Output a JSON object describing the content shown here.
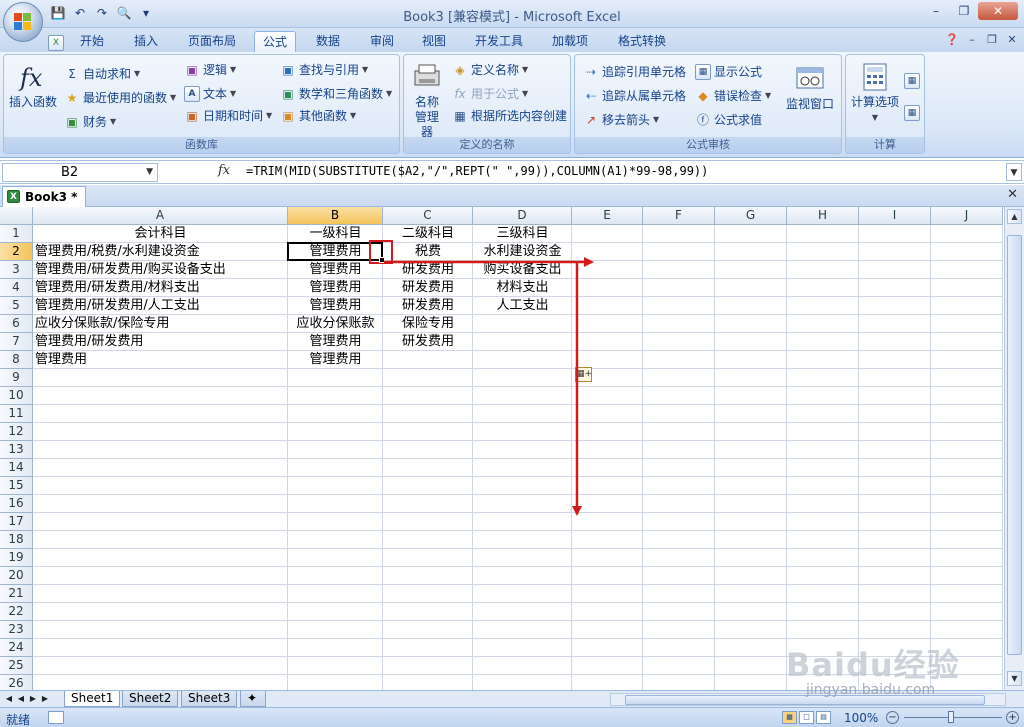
{
  "window": {
    "title": "Book3  [兼容模式] - Microsoft Excel"
  },
  "tabs": [
    {
      "label": "开始"
    },
    {
      "label": "插入"
    },
    {
      "label": "页面布局"
    },
    {
      "label": "公式",
      "active": true
    },
    {
      "label": "数据"
    },
    {
      "label": "审阅"
    },
    {
      "label": "视图"
    },
    {
      "label": "开发工具"
    },
    {
      "label": "加载项"
    },
    {
      "label": "格式转换"
    }
  ],
  "ribbon": {
    "function_library": {
      "label": "函数库",
      "insert_function": "插入函数",
      "autosum": "自动求和",
      "recent": "最近使用的函数",
      "financial": "财务",
      "logical": "逻辑",
      "text": "文本",
      "datetime": "日期和时间",
      "lookup": "查找与引用",
      "math": "数学和三角函数",
      "more": "其他函数"
    },
    "defined_names": {
      "label": "定义的名称",
      "name_manager": "名称管理器",
      "define_name": "定义名称",
      "use_in_formula": "用于公式",
      "create_from_selection": "根据所选内容创建"
    },
    "formula_auditing": {
      "label": "公式审核",
      "trace_precedents": "追踪引用单元格",
      "trace_dependents": "追踪从属单元格",
      "remove_arrows": "移去箭头",
      "show_formulas": "显示公式",
      "error_checking": "错误检查",
      "evaluate": "公式求值",
      "watch_window": "监视窗口"
    },
    "calculation": {
      "label": "计算",
      "options": "计算选项"
    }
  },
  "formula_bar": {
    "name_box": "B2",
    "fx": "fx",
    "formula": "=TRIM(MID(SUBSTITUTE($A2,\"/\",REPT(\" \",99)),COLUMN(A1)*99-98,99))"
  },
  "workbook_tab": "Book3 *",
  "columns": [
    "A",
    "B",
    "C",
    "D",
    "E",
    "F",
    "G",
    "H",
    "I",
    "J"
  ],
  "rows": [
    "1",
    "2",
    "3",
    "4",
    "5",
    "6",
    "7",
    "8",
    "9",
    "10",
    "11",
    "12",
    "13",
    "14",
    "15",
    "16",
    "17",
    "18",
    "19",
    "20",
    "21",
    "22",
    "23",
    "24",
    "25",
    "26"
  ],
  "cells": {
    "A1": "会计科目",
    "B1": "一级科目",
    "C1": "二级科目",
    "D1": "三级科目",
    "A2": "管理费用/税费/水利建设资金",
    "B2": "管理费用",
    "C2": "税费",
    "D2": "水利建设资金",
    "A3": "管理费用/研发费用/购买设备支出",
    "B3": "管理费用",
    "C3": "研发费用",
    "D3": "购买设备支出",
    "A4": "管理费用/研发费用/材料支出",
    "B4": "管理费用",
    "C4": "研发费用",
    "D4": "材料支出",
    "A5": "管理费用/研发费用/人工支出",
    "B5": "管理费用",
    "C5": "研发费用",
    "D5": "人工支出",
    "A6": "应收分保账款/保险专用",
    "B6": "应收分保账款",
    "C6": "保险专用",
    "A7": "管理费用/研发费用",
    "B7": "管理费用",
    "C7": "研发费用",
    "A8": "管理费用",
    "B8": "管理费用"
  },
  "sheets": [
    "Sheet1",
    "Sheet2",
    "Sheet3"
  ],
  "status": {
    "ready": "就绪",
    "zoom": "100%"
  },
  "watermark": {
    "brand": "Baidu经验",
    "url": "jingyan.baidu.com"
  },
  "colors": {
    "accent_red": "#d31b1b",
    "excel_green": "#2f8a3d"
  }
}
